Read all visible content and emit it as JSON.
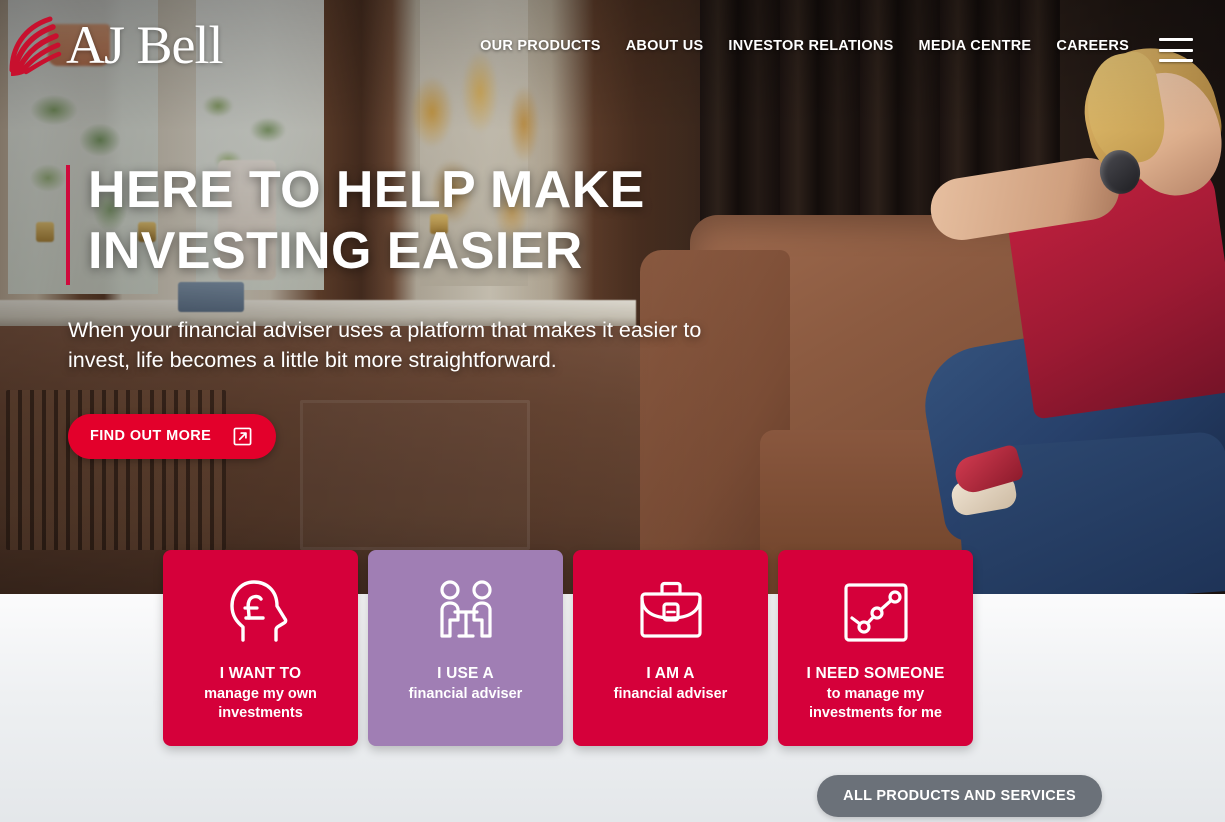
{
  "brand": {
    "name": "AJ Bell",
    "logo_mark": "feather-swoosh-icon",
    "accent_red": "#cf0a3c",
    "card_red": "#d5003a",
    "card_purple": "#a07eb4",
    "button_red": "#e3002b",
    "button_grey": "#6b7179"
  },
  "nav": {
    "items": [
      {
        "label": "OUR PRODUCTS"
      },
      {
        "label": "ABOUT US"
      },
      {
        "label": "INVESTOR RELATIONS"
      },
      {
        "label": "MEDIA CENTRE"
      },
      {
        "label": "CAREERS"
      }
    ],
    "menu_icon": "hamburger-menu-icon"
  },
  "hero": {
    "headline_line1": "HERE TO HELP MAKE",
    "headline_line2": "INVESTING EASIER",
    "subhead": "When your financial adviser uses a platform that makes it easier to invest, life becomes a little bit more straightforward.",
    "cta_label": "FIND OUT MORE",
    "cta_icon": "external-link-icon"
  },
  "cards": [
    {
      "line1": "I WANT TO",
      "line2": "manage my own investments",
      "icon": "head-with-pound-icon",
      "color": "red"
    },
    {
      "line1": "I USE A",
      "line2": "financial adviser",
      "icon": "two-people-meeting-icon",
      "color": "purple"
    },
    {
      "line1": "I AM A",
      "line2": "financial adviser",
      "icon": "briefcase-icon",
      "color": "red"
    },
    {
      "line1": "I NEED SOMEONE",
      "line2": "to manage my investments for me",
      "icon": "line-chart-icon",
      "color": "red"
    }
  ],
  "footer": {
    "all_products_label": "ALL PRODUCTS AND SERVICES"
  }
}
